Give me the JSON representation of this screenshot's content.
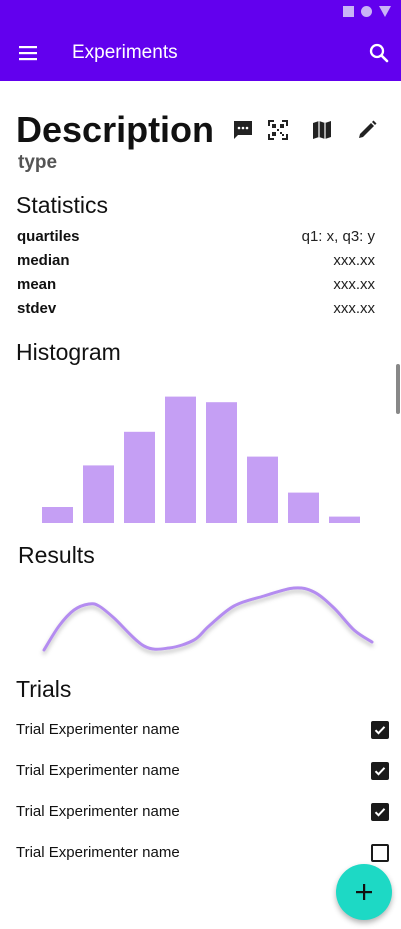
{
  "colors": {
    "primary": "#6200ee",
    "bar": "#c59ff4",
    "curve": "#b48cf0",
    "fab": "#1dd9c5"
  },
  "app_bar": {
    "title": "Experiments",
    "menu_icon": "menu-icon",
    "search_icon": "search-icon"
  },
  "description": {
    "title": "Description",
    "type": "type",
    "actions": [
      "comment-icon",
      "qr-code-icon",
      "map-icon",
      "edit-icon"
    ]
  },
  "statistics": {
    "title": "Statistics",
    "rows": [
      {
        "label": "quartiles",
        "value": "q1: x, q3: y"
      },
      {
        "label": "median",
        "value": "xxx.xx"
      },
      {
        "label": "mean",
        "value": "xxx.xx"
      },
      {
        "label": "stdev",
        "value": "xxx.xx"
      }
    ]
  },
  "histogram": {
    "title": "Histogram",
    "chart_data": {
      "type": "bar",
      "values": [
        2,
        7.2,
        11.4,
        15.8,
        15.1,
        8.3,
        3.8,
        0.8
      ],
      "ylim": [
        0,
        16
      ]
    }
  },
  "results": {
    "title": "Results",
    "chart_data": {
      "type": "line",
      "x": [
        0,
        15,
        30,
        45,
        55,
        70,
        100,
        125,
        150,
        165,
        190,
        220,
        250,
        270,
        290,
        310,
        328
      ],
      "y": [
        4,
        16,
        24,
        27,
        26,
        20,
        6,
        5,
        9,
        16,
        26,
        31,
        35,
        33,
        25,
        14,
        8
      ]
    }
  },
  "trials": {
    "title": "Trials",
    "items": [
      {
        "name": "Trial Experimenter name",
        "checked": true
      },
      {
        "name": "Trial Experimenter name",
        "checked": true
      },
      {
        "name": "Trial Experimenter name",
        "checked": true
      },
      {
        "name": "Trial Experimenter name",
        "checked": false
      }
    ]
  },
  "fab": {
    "icon": "add-icon"
  }
}
